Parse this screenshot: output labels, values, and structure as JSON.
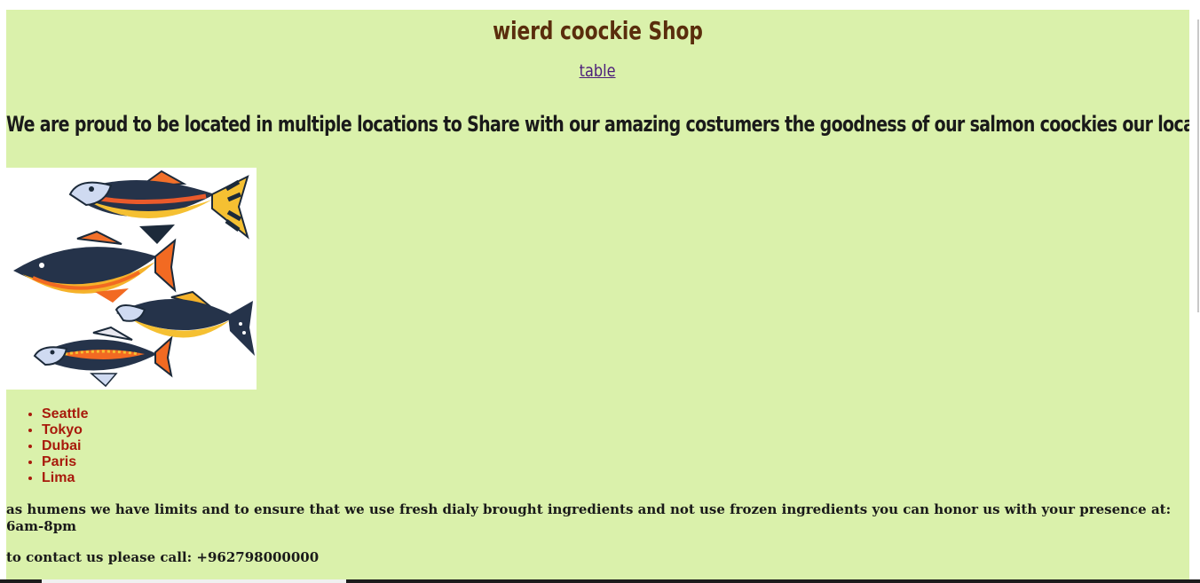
{
  "header": {
    "title": "wierd coockie Shop",
    "table_link": "table"
  },
  "intro": "We are proud to be located in multiple locations to Share with our amazing costumers the goodness of our salmon coockies our locations:",
  "locations": [
    "Seattle",
    "Tokyo",
    "Dubai",
    "Paris",
    "Lima"
  ],
  "hours_note": "as humens we have limits and to ensure that we use fresh dialy brought ingredients and not use frozen ingredients you can honor us with your presence at: 6am-8pm",
  "contact": "to contact us please call: +962798000000",
  "colors": {
    "page_background": "#daf1ab",
    "title": "#5a2d0c",
    "link": "#4b1d7a",
    "list_text": "#a81a0c",
    "body_text": "#1a1a1a"
  }
}
